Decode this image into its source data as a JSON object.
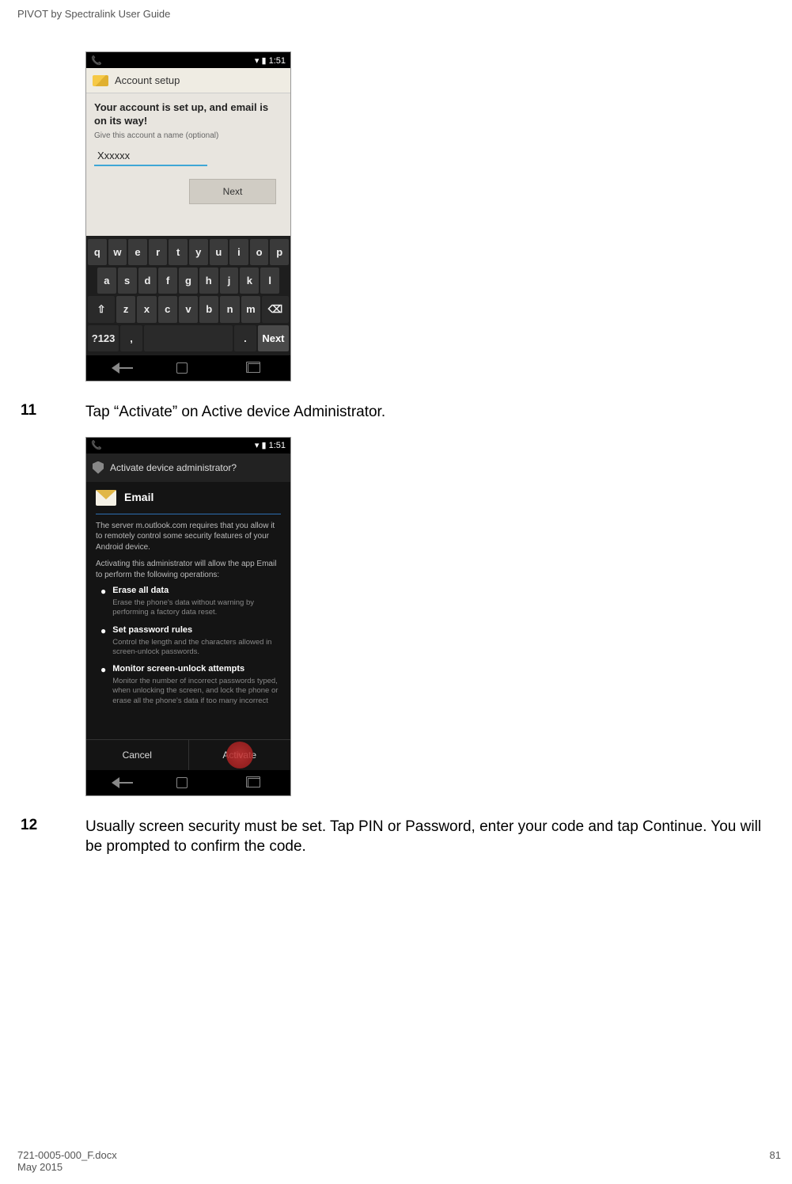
{
  "doc": {
    "header": "PIVOT by Spectralink User Guide",
    "footer_file": "721-0005-000_F.docx",
    "footer_date": "May 2015",
    "footer_page": "81"
  },
  "phone1": {
    "status_time": "1:51",
    "appbar_title": "Account setup",
    "msg_bold": "Your account is set up, and email is on its way!",
    "msg_small": "Give this account a name (optional)",
    "input_value": "Xxxxxx",
    "next_button": "Next",
    "keyboard": {
      "row1": [
        "q",
        "w",
        "e",
        "r",
        "t",
        "y",
        "u",
        "i",
        "o",
        "p"
      ],
      "row2": [
        "a",
        "s",
        "d",
        "f",
        "g",
        "h",
        "j",
        "k",
        "l"
      ],
      "row3_shift": "⇧",
      "row3": [
        "z",
        "x",
        "c",
        "v",
        "b",
        "n",
        "m"
      ],
      "row3_del": "⌫",
      "row4_sym": "?123",
      "row4_comma": ",",
      "row4_space": " ",
      "row4_period": ".",
      "row4_next": "Next"
    }
  },
  "step11": {
    "num": "11",
    "text": "Tap “Activate” on Active device Administrator."
  },
  "phone2": {
    "status_time": "1:51",
    "appbar_title": "Activate device administrator?",
    "email_label": "Email",
    "para1": "The server m.outlook.com requires that you allow it to remotely control some security features of your Android device.",
    "para2": "Activating this administrator will allow the app Email to perform the following operations:",
    "items": [
      {
        "title": "Erase all data",
        "desc": "Erase the phone's data without warning by performing a factory data reset."
      },
      {
        "title": "Set password rules",
        "desc": "Control the length and the characters allowed in screen-unlock passwords."
      },
      {
        "title": "Monitor screen-unlock attempts",
        "desc": "Monitor the number of incorrect passwords typed, when unlocking the screen, and lock the phone or erase all the phone's data if too many incorrect"
      }
    ],
    "cancel": "Cancel",
    "activate": "Activate"
  },
  "step12": {
    "num": "12",
    "text": "Usually screen security must be set. Tap PIN or Password, enter your code and tap Continue. You will be prompted to confirm the code."
  }
}
